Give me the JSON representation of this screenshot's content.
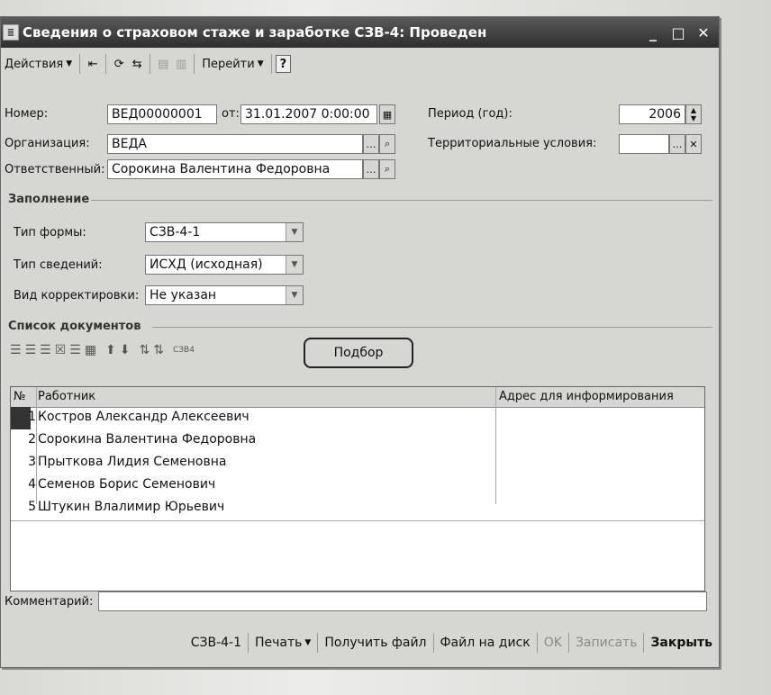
{
  "window": {
    "title": "Сведения о страховом стаже и заработке СЗВ-4: Проведен",
    "controls": [
      "_",
      "□",
      "✕"
    ]
  },
  "toolbar": {
    "actions_label": "Действия",
    "goto_label": "Перейти",
    "help_label": "?"
  },
  "form": {
    "number_label": "Номер:",
    "number_value": "ВЕД00000001",
    "from_label": "от:",
    "date_value": "31.01.2007  0:00:00",
    "period_label": "Период (год):",
    "period_value": "2006",
    "org_label": "Организация:",
    "org_value": "ВЕДА",
    "territory_label": "Территориальные условия:",
    "territory_value": "",
    "responsible_label": "Ответственный:",
    "responsible_value": "Сорокина Валентина Федоровна"
  },
  "filling": {
    "section_label": "Заполнение",
    "form_type_label": "Тип формы:",
    "form_type_value": "СЗВ-4-1",
    "info_type_label": "Тип сведений:",
    "info_type_value": "ИСХД (исходная)",
    "correction_label": "Вид корректировки:",
    "correction_value": "Не указан"
  },
  "documents": {
    "section_label": "Список документов",
    "pick_label": "Подбор",
    "pick_icon_text": "СЗВ4",
    "columns": {
      "num": "№",
      "worker": "Работник",
      "address": "Адрес для информирования"
    },
    "rows": [
      {
        "num": "1",
        "worker": "Костров Александр Алексеевич"
      },
      {
        "num": "2",
        "worker": "Сорокина Валентина Федоровна"
      },
      {
        "num": "3",
        "worker": "Прыткова Лидия Семеновна"
      },
      {
        "num": "4",
        "worker": "Семенов Борис Семенович"
      },
      {
        "num": "5",
        "worker": "Штукин Влалимир Юрьевич"
      }
    ]
  },
  "comment": {
    "label": "Комментарий:",
    "value": ""
  },
  "bottom": {
    "form_label": "СЗВ-4-1",
    "print_label": "Печать",
    "get_file_label": "Получить файл",
    "file_to_disk_label": "Файл на диск",
    "ok_label": "OK",
    "save_label": "Записать",
    "close_label": "Закрыть"
  }
}
